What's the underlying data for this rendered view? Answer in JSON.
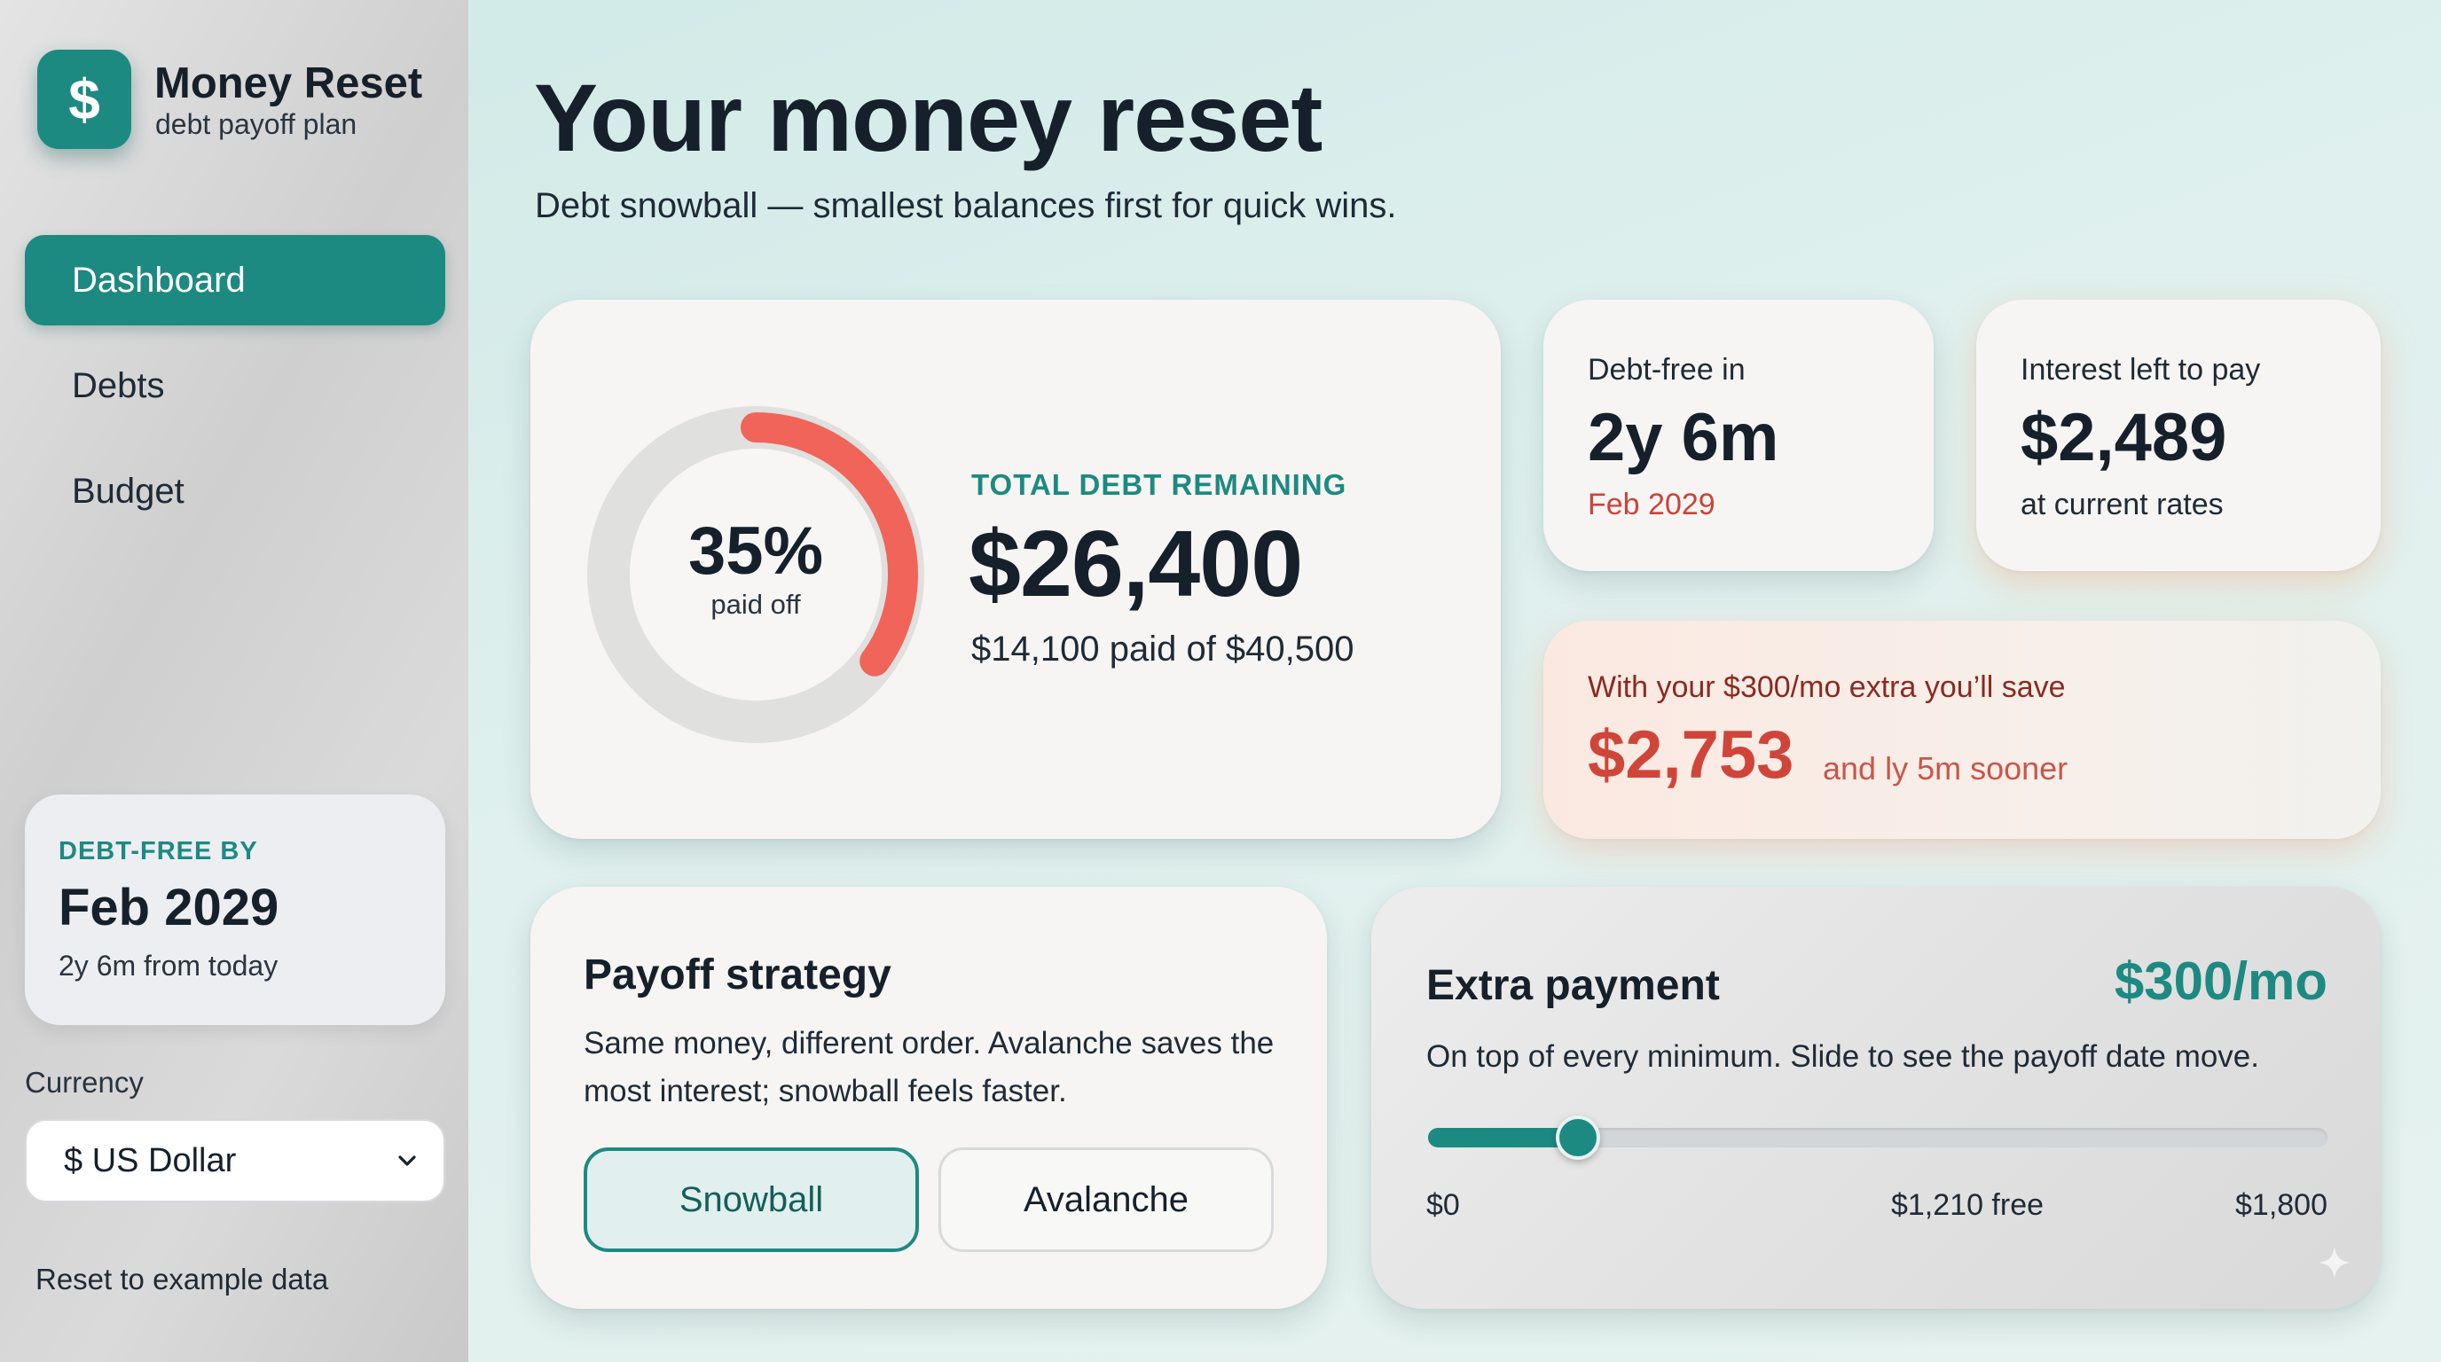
{
  "app": {
    "logo_symbol": "$",
    "name": "Money Reset",
    "subtitle": "debt payoff plan"
  },
  "nav": {
    "items": [
      {
        "label": "Dashboard",
        "active": true
      },
      {
        "label": "Debts",
        "active": false
      },
      {
        "label": "Budget",
        "active": false
      }
    ]
  },
  "sidebar_card": {
    "label": "DEBT-FREE BY",
    "date": "Feb 2029",
    "note": "2y 6m from today"
  },
  "currency": {
    "label": "Currency",
    "value": "$ US Dollar"
  },
  "reset_label": "Reset to example data",
  "header": {
    "title": "Your money reset",
    "subtitle": "Debt snowball — smallest balances first for quick wins."
  },
  "total": {
    "percent_paid": 35,
    "percent_text": "35%",
    "ring_label": "paid off",
    "label": "TOTAL DEBT REMAINING",
    "value": "$26,400",
    "note": "$14,100 paid of $40,500"
  },
  "debt_free_stat": {
    "label": "Debt-free in",
    "value": "2y 6m",
    "note": "Feb 2029"
  },
  "interest_stat": {
    "label": "Interest left to pay",
    "value": "$2,489",
    "note": "at current rates"
  },
  "savings": {
    "line": "With your $300/mo extra you’ll save",
    "value": "$2,753",
    "sooner": "and ly 5m sooner"
  },
  "strategy": {
    "title": "Payoff strategy",
    "description": "Same money, different order. Avalanche saves the most interest; snowball feels faster.",
    "options": [
      {
        "label": "Snowball",
        "selected": true
      },
      {
        "label": "Avalanche",
        "selected": false
      }
    ]
  },
  "extra": {
    "title": "Extra payment",
    "amount": "$300/mo",
    "description": "On top of every minimum. Slide to see the payoff date move.",
    "slider": {
      "min": 0,
      "max": 1800,
      "value": 300
    },
    "min_label": "$0",
    "mid_label": "$1,210 free",
    "max_label": "$1,800"
  },
  "colors": {
    "accent": "#1d8a82",
    "ring_progress": "#f0645a",
    "savings_red": "#d0453a"
  },
  "icons": {
    "logo": "dollar-sign-icon",
    "dropdown": "chevron-down-icon",
    "decor": "sparkle-icon"
  }
}
